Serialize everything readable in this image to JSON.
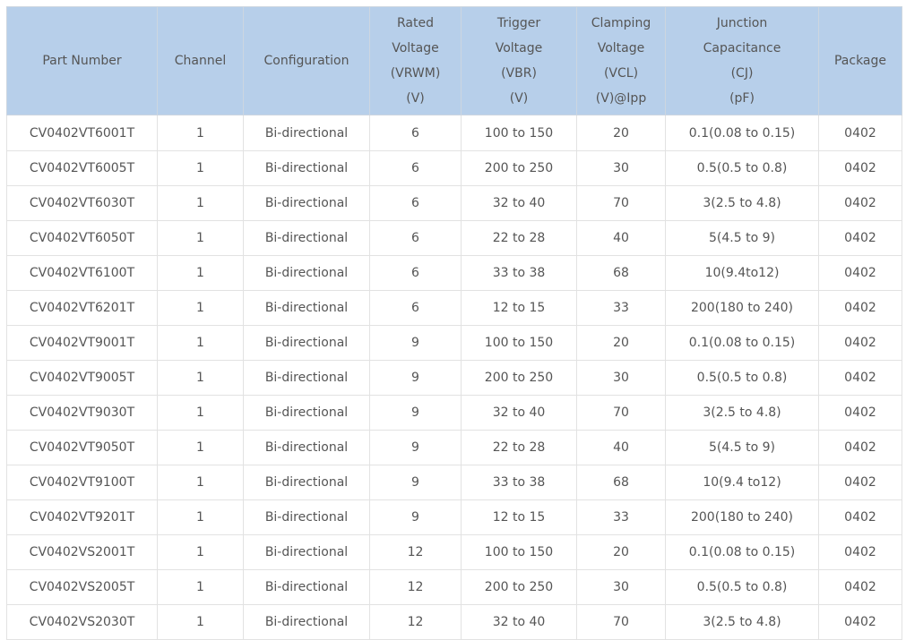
{
  "table": {
    "headers": [
      {
        "key": "part_number",
        "lines": [
          "Part Number"
        ]
      },
      {
        "key": "channel",
        "lines": [
          "Channel"
        ]
      },
      {
        "key": "configuration",
        "lines": [
          "Configuration"
        ]
      },
      {
        "key": "rated_voltage",
        "lines": [
          "Rated",
          "Voltage",
          "(VRWM)",
          "(V)"
        ]
      },
      {
        "key": "trigger_voltage",
        "lines": [
          "Trigger",
          "Voltage",
          "(VBR)",
          "(V)"
        ]
      },
      {
        "key": "clamping_voltage",
        "lines": [
          "Clamping",
          "Voltage",
          "(VCL)",
          "(V)@Ipp"
        ]
      },
      {
        "key": "junction_capacitance",
        "lines": [
          "Junction",
          "Capacitance",
          "(CJ)",
          "(pF)"
        ]
      },
      {
        "key": "package",
        "lines": [
          "Package"
        ]
      }
    ],
    "rows": [
      [
        "CV0402VT6001T",
        "1",
        "Bi-directional",
        "6",
        "100 to 150",
        "20",
        "0.1(0.08 to 0.15)",
        "0402"
      ],
      [
        "CV0402VT6005T",
        "1",
        "Bi-directional",
        "6",
        "200 to 250",
        "30",
        "0.5(0.5 to 0.8)",
        "0402"
      ],
      [
        "CV0402VT6030T",
        "1",
        "Bi-directional",
        "6",
        "32 to 40",
        "70",
        "3(2.5 to 4.8)",
        "0402"
      ],
      [
        "CV0402VT6050T",
        "1",
        "Bi-directional",
        "6",
        "22 to 28",
        "40",
        "5(4.5 to 9)",
        "0402"
      ],
      [
        "CV0402VT6100T",
        "1",
        "Bi-directional",
        "6",
        "33 to 38",
        "68",
        "10(9.4to12)",
        "0402"
      ],
      [
        "CV0402VT6201T",
        "1",
        "Bi-directional",
        "6",
        "12 to 15",
        "33",
        "200(180 to 240)",
        "0402"
      ],
      [
        "CV0402VT9001T",
        "1",
        "Bi-directional",
        "9",
        "100 to 150",
        "20",
        "0.1(0.08  to 0.15)",
        "0402"
      ],
      [
        "CV0402VT9005T",
        "1",
        "Bi-directional",
        "9",
        "200 to 250",
        "30",
        "0.5(0.5 to 0.8)",
        "0402"
      ],
      [
        "CV0402VT9030T",
        "1",
        "Bi-directional",
        "9",
        "32 to 40",
        "70",
        "3(2.5 to 4.8)",
        "0402"
      ],
      [
        "CV0402VT9050T",
        "1",
        "Bi-directional",
        "9",
        "22 to 28",
        "40",
        "5(4.5 to 9)",
        "0402"
      ],
      [
        "CV0402VT9100T",
        "1",
        "Bi-directional",
        "9",
        "33 to 38",
        "68",
        "10(9.4 to12)",
        "0402"
      ],
      [
        "CV0402VT9201T",
        "1",
        "Bi-directional",
        "9",
        "12 to 15",
        "33",
        "200(180 to 240)",
        "0402"
      ],
      [
        "CV0402VS2001T",
        "1",
        "Bi-directional",
        "12",
        "100 to 150",
        "20",
        "0.1(0.08 to 0.15)",
        "0402"
      ],
      [
        "CV0402VS2005T",
        "1",
        "Bi-directional",
        "12",
        "200 to 250",
        "30",
        "0.5(0.5 to 0.8)",
        "0402"
      ],
      [
        "CV0402VS2030T",
        "1",
        "Bi-directional",
        "12",
        "32 to 40",
        "70",
        "3(2.5 to 4.8)",
        "0402"
      ]
    ]
  },
  "colors": {
    "header_background": "#b7cfea",
    "text": "#555555",
    "grid": "#e2e2e2"
  }
}
